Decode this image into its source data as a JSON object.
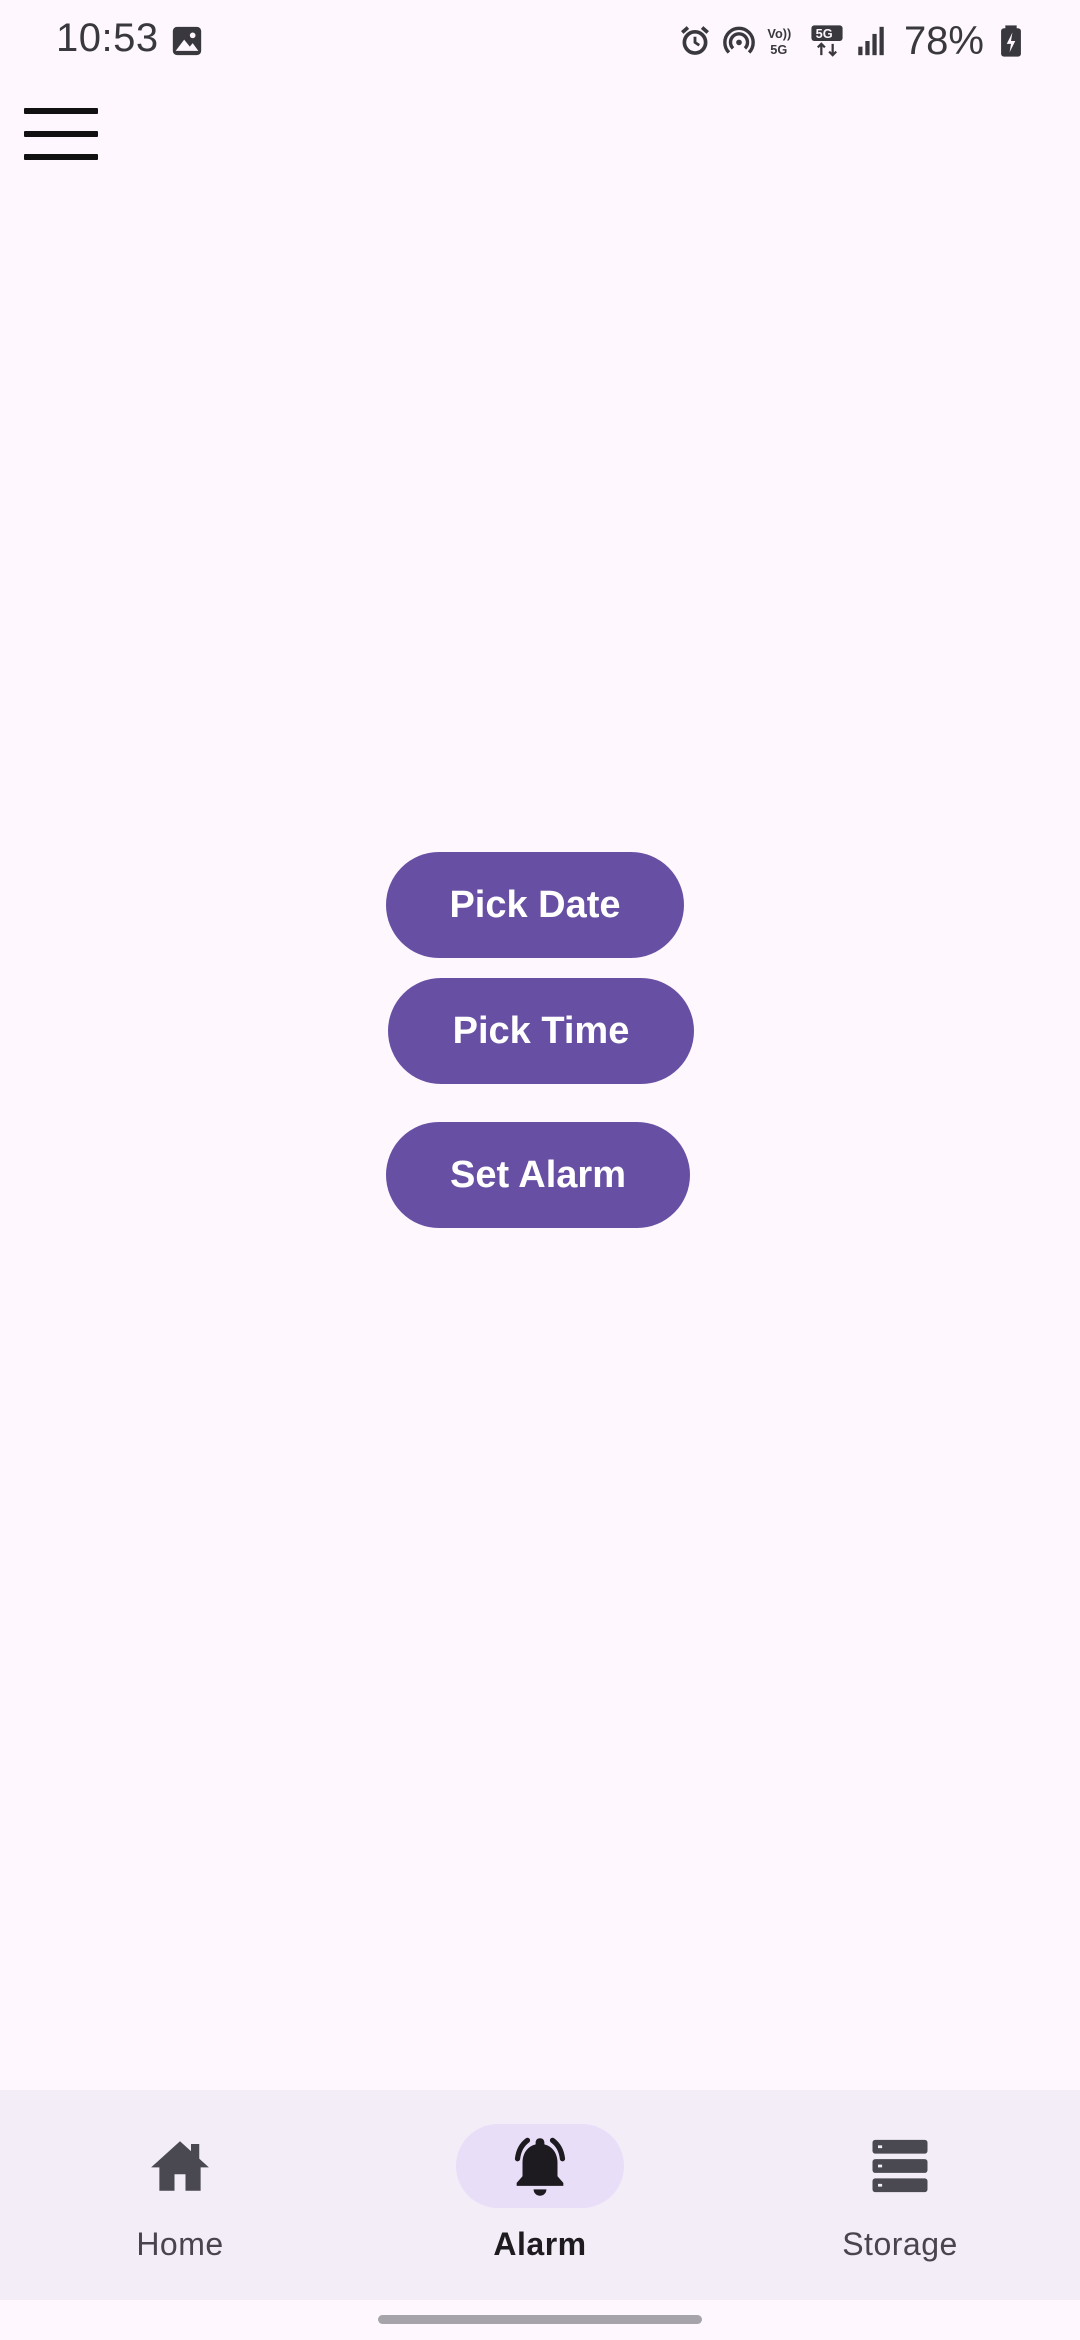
{
  "status_bar": {
    "time": "10:53",
    "battery_percent": "78%",
    "icons": [
      "gallery-icon",
      "alarm-icon",
      "hotspot-icon",
      "volte-icon",
      "5g-icon",
      "signal-icon",
      "battery-icon"
    ]
  },
  "toolbar": {
    "menu_icon": "hamburger-menu-icon"
  },
  "actions": {
    "pick_date": "Pick Date",
    "pick_time": "Pick Time",
    "set_alarm": "Set Alarm"
  },
  "bottom_nav": {
    "items": [
      {
        "label": "Home",
        "icon": "home-icon",
        "active": false
      },
      {
        "label": "Alarm",
        "icon": "bell-icon",
        "active": true
      },
      {
        "label": "Storage",
        "icon": "storage-icon",
        "active": false
      }
    ]
  },
  "colors": {
    "background": "#fef7fd",
    "primary": "#6750a4",
    "nav_background": "#f3edf7",
    "nav_indicator": "#e8def8"
  }
}
